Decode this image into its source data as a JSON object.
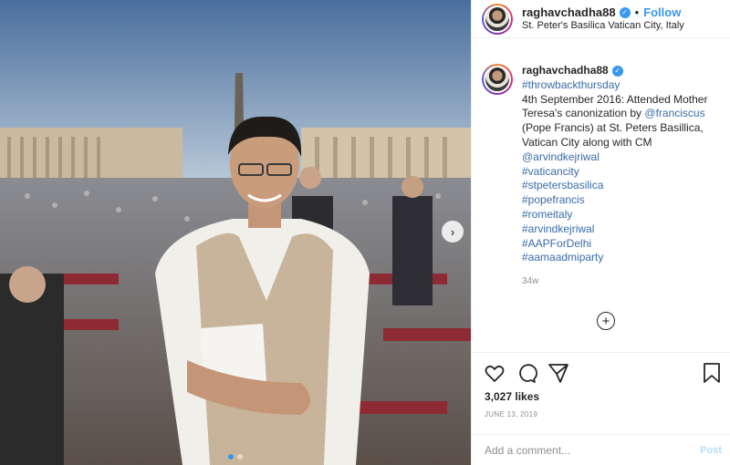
{
  "header": {
    "username": "raghavchadha88",
    "verified_icon": "verified-badge-icon",
    "separator": "•",
    "follow_label": "Follow",
    "location": "St. Peter's Basilica Vatican City, Italy"
  },
  "caption": {
    "username": "raghavchadha88",
    "first_tag": "#throwbackthursday",
    "line1": "4th September 2016: Attended Mother Teresa's canonization by",
    "mention1": "@franciscus",
    "line2": " (Pope Francis) at St. Peters Basillica, Vatican City along with CM ",
    "mention2": "@arvindkejriwal",
    "hashtags": [
      "#vaticancity",
      "#stpetersbasilica",
      "#popefrancis",
      "#romeitaly",
      "#arvindkejriwal",
      "#AAPForDelhi",
      "#aamaadmiparty"
    ],
    "time_ago": "34w"
  },
  "more_comments_icon": "plus-circle-icon",
  "actions": {
    "like_icon": "heart-icon",
    "comment_icon": "comment-bubble-icon",
    "share_icon": "paper-plane-icon",
    "save_icon": "bookmark-icon",
    "likes": "3,027 likes",
    "date": "JUNE 13, 2019"
  },
  "comment": {
    "placeholder": "Add a comment...",
    "post_label": "Post"
  },
  "carousel": {
    "next_icon": "chevron-right-icon",
    "slide_count": 2,
    "active_index": 0
  },
  "colors": {
    "link": "#3897f0",
    "hashtag": "#3a6ba8",
    "muted": "#8e8e8e",
    "post_disabled": "#b2dffc"
  }
}
